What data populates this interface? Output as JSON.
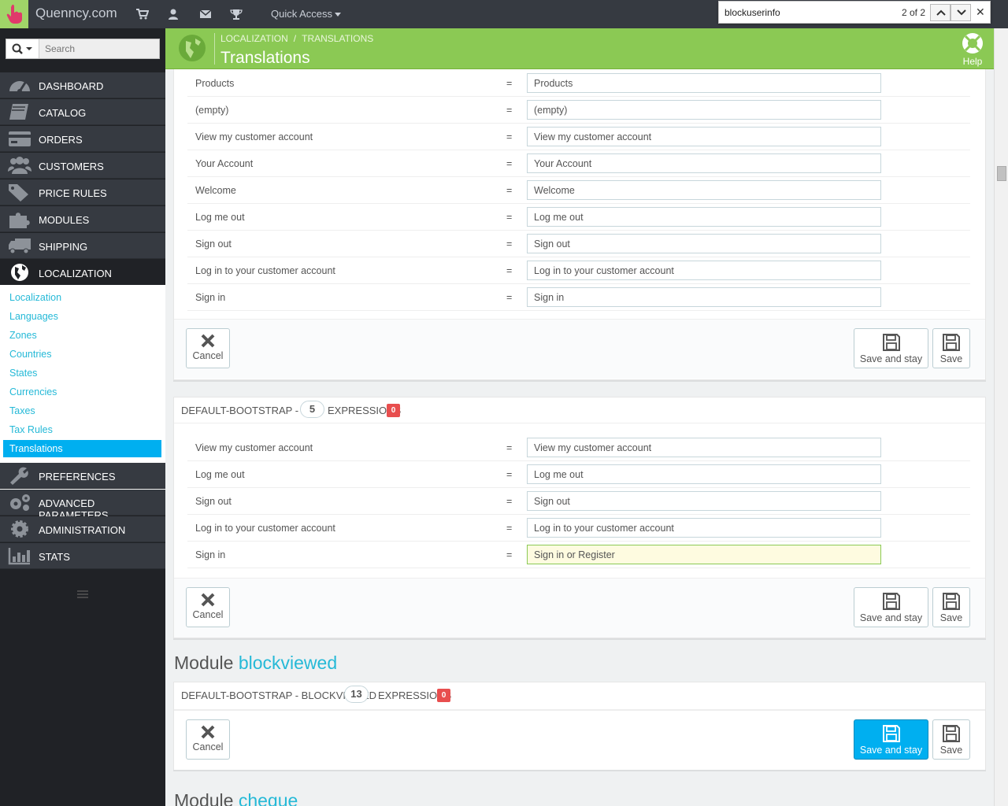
{
  "topbar": {
    "brand": "Quenncy.com",
    "quick_access": "Quick Access"
  },
  "findbar": {
    "query": "blockuserinfo",
    "count": "2 of 2"
  },
  "sidebar": {
    "search_placeholder": "Search",
    "menu": [
      {
        "label": "DASHBOARD",
        "icon": "dashboard-icon"
      },
      {
        "label": "CATALOG",
        "icon": "book-icon"
      },
      {
        "label": "ORDERS",
        "icon": "credit-card-icon"
      },
      {
        "label": "CUSTOMERS",
        "icon": "users-icon"
      },
      {
        "label": "PRICE RULES",
        "icon": "tags-icon"
      },
      {
        "label": "MODULES",
        "icon": "puzzle-icon"
      },
      {
        "label": "SHIPPING",
        "icon": "truck-icon"
      },
      {
        "label": "LOCALIZATION",
        "icon": "globe-icon"
      },
      {
        "label": "PREFERENCES",
        "icon": "wrench-icon"
      },
      {
        "label": "ADVANCED PARAMETERS",
        "icon": "cogs-icon"
      },
      {
        "label": "ADMINISTRATION",
        "icon": "cog-icon"
      },
      {
        "label": "STATS",
        "icon": "bar-chart-icon"
      }
    ],
    "submenu": [
      "Localization",
      "Languages",
      "Zones",
      "Countries",
      "States",
      "Currencies",
      "Taxes",
      "Tax Rules",
      "Translations"
    ]
  },
  "header": {
    "breadcrumb": [
      "LOCALIZATION",
      "TRANSLATIONS"
    ],
    "title": "Translations",
    "help": "Help"
  },
  "panel1": {
    "rows": [
      {
        "source": "Products",
        "value": "Products"
      },
      {
        "source": "(empty)",
        "value": "(empty)"
      },
      {
        "source": "View my customer account",
        "value": "View my customer account"
      },
      {
        "source": "Your Account",
        "value": "Your Account"
      },
      {
        "source": "Welcome",
        "value": "Welcome"
      },
      {
        "source": "Log me out",
        "value": "Log me out"
      },
      {
        "source": "Sign out",
        "value": "Sign out"
      },
      {
        "source": "Log in to your customer account",
        "value": "Log in to your customer account"
      },
      {
        "source": "Sign in",
        "value": "Sign in"
      }
    ]
  },
  "panel2": {
    "title": "DEFAULT-BOOTSTRAP - NAV",
    "count": "5",
    "expressions_label": "EXPRESSIONS",
    "missing": "0",
    "rows": [
      {
        "source": "View my customer account",
        "value": "View my customer account"
      },
      {
        "source": "Log me out",
        "value": "Log me out"
      },
      {
        "source": "Sign out",
        "value": "Sign out"
      },
      {
        "source": "Log in to your customer account",
        "value": "Log in to your customer account"
      },
      {
        "source": "Sign in",
        "value": "Sign in or Register"
      }
    ]
  },
  "module_blockviewed": {
    "prefix": "Module",
    "name": "blockviewed",
    "panel_title": "DEFAULT-BOOTSTRAP - BLOCKVIEWED",
    "count": "13",
    "expressions_label": "EXPRESSIONS",
    "missing": "0"
  },
  "module_cheque": {
    "prefix": "Module",
    "name": "cheque"
  },
  "buttons": {
    "cancel": "Cancel",
    "save_and_stay": "Save and stay",
    "save": "Save"
  },
  "colors": {
    "header_green": "#8bc954",
    "sidebar_dark": "#363a41",
    "accent_blue": "#00aff0",
    "badge_red": "#e84e4e"
  }
}
